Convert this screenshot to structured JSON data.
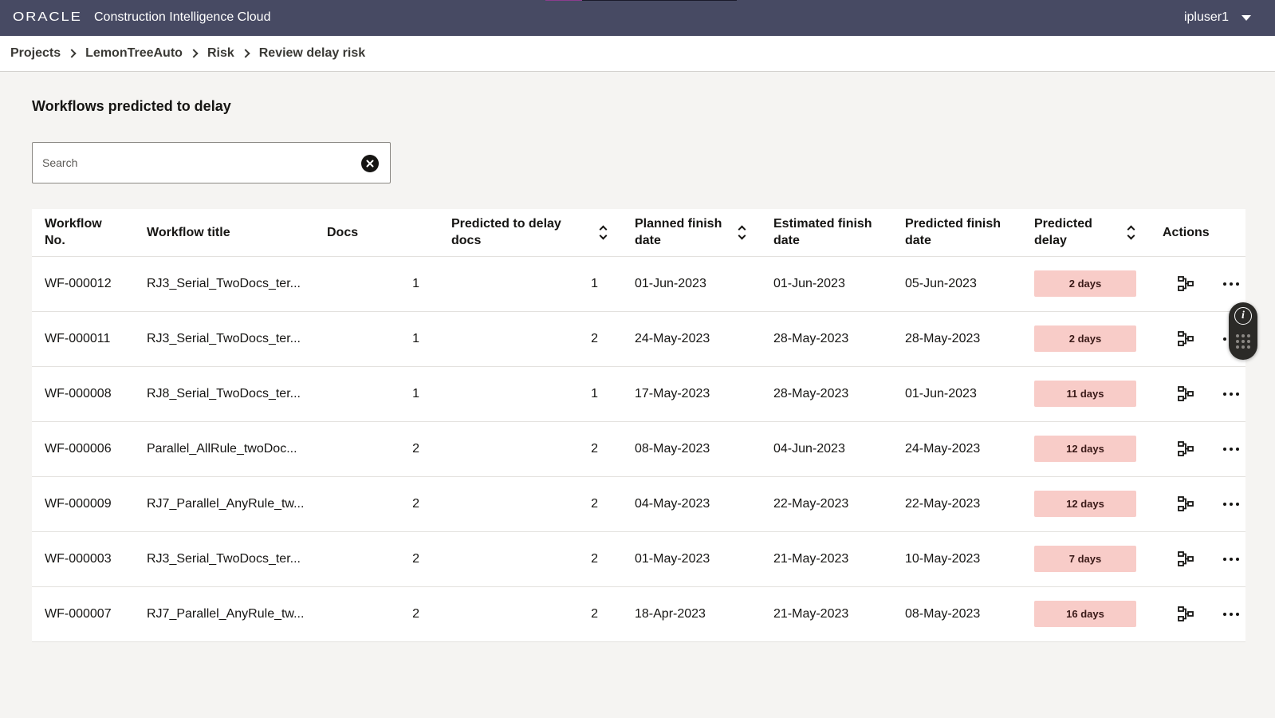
{
  "header": {
    "logo": "ORACLE",
    "product": "Construction Intelligence Cloud",
    "user": "ipluser1"
  },
  "breadcrumb": [
    "Projects",
    "LemonTreeAuto",
    "Risk",
    "Review delay risk"
  ],
  "page": {
    "title": "Workflows predicted to delay"
  },
  "search": {
    "placeholder": "Search",
    "value": ""
  },
  "table": {
    "columns": {
      "wf_no": "Workflow No.",
      "title": "Workflow title",
      "docs": "Docs",
      "pred_docs": "Predicted to delay docs",
      "planned": "Planned finish date",
      "estimated": "Estimated finish date",
      "predicted_finish": "Predicted finish date",
      "predicted_delay": "Predicted delay",
      "actions": "Actions"
    },
    "rows": [
      {
        "wf_no": "WF-000012",
        "title": "RJ3_Serial_TwoDocs_ter...",
        "docs": "1",
        "pred_docs": "1",
        "planned": "01-Jun-2023",
        "estimated": "01-Jun-2023",
        "predicted_finish": "05-Jun-2023",
        "delay": "2 days"
      },
      {
        "wf_no": "WF-000011",
        "title": "RJ3_Serial_TwoDocs_ter...",
        "docs": "1",
        "pred_docs": "2",
        "planned": "24-May-2023",
        "estimated": "28-May-2023",
        "predicted_finish": "28-May-2023",
        "delay": "2 days"
      },
      {
        "wf_no": "WF-000008",
        "title": "RJ8_Serial_TwoDocs_ter...",
        "docs": "1",
        "pred_docs": "1",
        "planned": "17-May-2023",
        "estimated": "28-May-2023",
        "predicted_finish": "01-Jun-2023",
        "delay": "11 days"
      },
      {
        "wf_no": "WF-000006",
        "title": "Parallel_AllRule_twoDoc...",
        "docs": "2",
        "pred_docs": "2",
        "planned": "08-May-2023",
        "estimated": "04-Jun-2023",
        "predicted_finish": "24-May-2023",
        "delay": "12 days"
      },
      {
        "wf_no": "WF-000009",
        "title": "RJ7_Parallel_AnyRule_tw...",
        "docs": "2",
        "pred_docs": "2",
        "planned": "04-May-2023",
        "estimated": "22-May-2023",
        "predicted_finish": "22-May-2023",
        "delay": "12 days"
      },
      {
        "wf_no": "WF-000003",
        "title": "RJ3_Serial_TwoDocs_ter...",
        "docs": "2",
        "pred_docs": "2",
        "planned": "01-May-2023",
        "estimated": "21-May-2023",
        "predicted_finish": "10-May-2023",
        "delay": "7 days"
      },
      {
        "wf_no": "WF-000007",
        "title": "RJ7_Parallel_AnyRule_tw...",
        "docs": "2",
        "pred_docs": "2",
        "planned": "18-Apr-2023",
        "estimated": "21-May-2023",
        "predicted_finish": "08-May-2023",
        "delay": "16 days"
      }
    ]
  },
  "colors": {
    "topbar": "#474a63",
    "delay_badge": "#f8ccc8",
    "background": "#f5f4f2"
  },
  "icons": {
    "clear": "close-circle-icon",
    "workflow": "workflow-diagram-icon",
    "more": "more-horizontal-icon",
    "info": "info-icon",
    "grip": "drag-grip-icon"
  }
}
